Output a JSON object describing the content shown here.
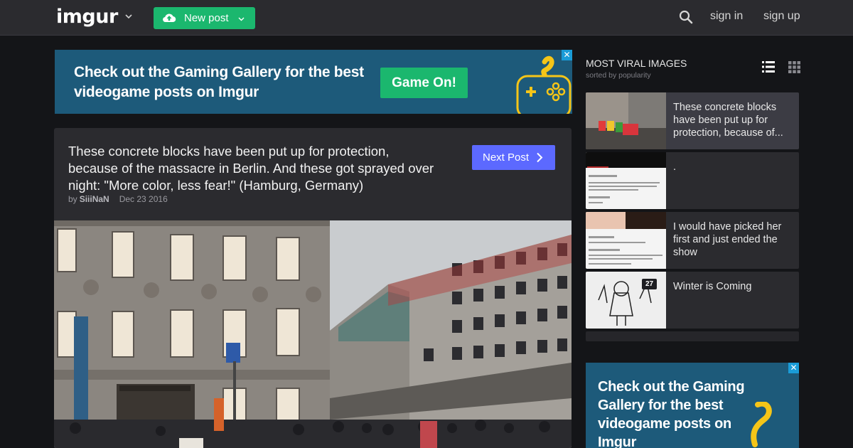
{
  "header": {
    "logo": "imgur",
    "new_post_label": "New post",
    "sign_in": "sign in",
    "sign_up": "sign up"
  },
  "ad_top": {
    "headline": "Check out the Gaming Gallery for the best videogame posts on Imgur",
    "cta": "Game On!",
    "close": "✕"
  },
  "post": {
    "title": "These concrete blocks have been put up for protection, because of the massacre in Berlin. And these got sprayed over night: \"More color, less fear!\" (Hamburg, Germany)",
    "by_label": "by",
    "author": "SiiiNaN",
    "date": "Dec 23 2016",
    "next_post": "Next Post"
  },
  "sidebar": {
    "title": "MOST VIRAL IMAGES",
    "subtitle": "sorted by popularity",
    "items": [
      {
        "caption": "These concrete blocks have been put up for protection, because of...",
        "active": true
      },
      {
        "caption": "."
      },
      {
        "caption": "I would have picked her first and just ended the show"
      },
      {
        "caption": "Winter is Coming",
        "badge": "27"
      }
    ]
  },
  "ad_side": {
    "headline": "Check out the Gaming Gallery for the best videogame posts on Imgur",
    "close": "✕"
  },
  "colors": {
    "brand_green": "#1bb76e",
    "next_button": "#5c69ff",
    "ad_background": "#1d5a7a",
    "page_background": "#141518",
    "card_background": "#2b2b2f"
  }
}
